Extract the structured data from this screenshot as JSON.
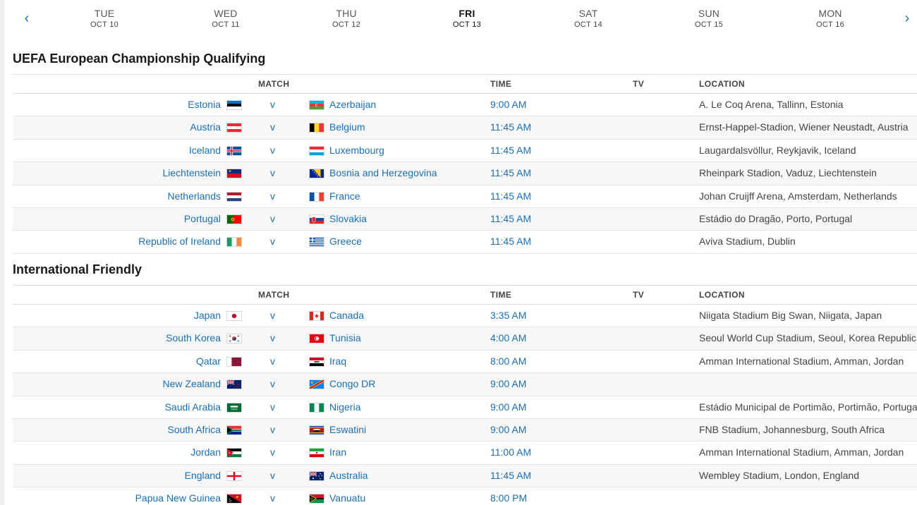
{
  "nav": {
    "prev_icon": "chevron-left-icon",
    "next_icon": "chevron-right-icon",
    "prev_glyph": "‹",
    "next_glyph": "›"
  },
  "days": [
    {
      "dow": "TUE",
      "date": "OCT 10",
      "active": false
    },
    {
      "dow": "WED",
      "date": "OCT 11",
      "active": false
    },
    {
      "dow": "THU",
      "date": "OCT 12",
      "active": false
    },
    {
      "dow": "FRI",
      "date": "OCT 13",
      "active": true
    },
    {
      "dow": "SAT",
      "date": "OCT 14",
      "active": false
    },
    {
      "dow": "SUN",
      "date": "OCT 15",
      "active": false
    },
    {
      "dow": "MON",
      "date": "OCT 16",
      "active": false
    }
  ],
  "columns": {
    "match": "MATCH",
    "time": "TIME",
    "tv": "TV",
    "location": "LOCATION"
  },
  "vs_label": "v",
  "colors": {
    "link": "#1a6fb5",
    "alt_row": "#f7f7f7"
  },
  "sections": [
    {
      "title": "UEFA European Championship Qualifying",
      "matches": [
        {
          "home": "Estonia",
          "home_flag": "estonia-flag-icon",
          "away": "Azerbaijan",
          "away_flag": "azerbaijan-flag-icon",
          "time": "9:00 AM",
          "location": "A. Le Coq Arena, Tallinn, Estonia"
        },
        {
          "home": "Austria",
          "home_flag": "austria-flag-icon",
          "away": "Belgium",
          "away_flag": "belgium-flag-icon",
          "time": "11:45 AM",
          "location": "Ernst-Happel-Stadion, Wiener Neustadt, Austria"
        },
        {
          "home": "Iceland",
          "home_flag": "iceland-flag-icon",
          "away": "Luxembourg",
          "away_flag": "luxembourg-flag-icon",
          "time": "11:45 AM",
          "location": "Laugardalsvöllur, Reykjavik, Iceland"
        },
        {
          "home": "Liechtenstein",
          "home_flag": "liechtenstein-flag-icon",
          "away": "Bosnia and Herzegovina",
          "away_flag": "bosnia-flag-icon",
          "time": "11:45 AM",
          "location": "Rheinpark Stadion, Vaduz, Liechtenstein"
        },
        {
          "home": "Netherlands",
          "home_flag": "netherlands-flag-icon",
          "away": "France",
          "away_flag": "france-flag-icon",
          "time": "11:45 AM",
          "location": "Johan Cruijff Arena, Amsterdam, Netherlands"
        },
        {
          "home": "Portugal",
          "home_flag": "portugal-flag-icon",
          "away": "Slovakia",
          "away_flag": "slovakia-flag-icon",
          "time": "11:45 AM",
          "location": "Estádio do Dragão, Porto, Portugal"
        },
        {
          "home": "Republic of Ireland",
          "home_flag": "ireland-flag-icon",
          "away": "Greece",
          "away_flag": "greece-flag-icon",
          "time": "11:45 AM",
          "location": "Aviva Stadium, Dublin"
        }
      ]
    },
    {
      "title": "International Friendly",
      "matches": [
        {
          "home": "Japan",
          "home_flag": "japan-flag-icon",
          "away": "Canada",
          "away_flag": "canada-flag-icon",
          "time": "3:35 AM",
          "location": "Niigata Stadium Big Swan, Niigata, Japan"
        },
        {
          "home": "South Korea",
          "home_flag": "south-korea-flag-icon",
          "away": "Tunisia",
          "away_flag": "tunisia-flag-icon",
          "time": "4:00 AM",
          "location": "Seoul World Cup Stadium, Seoul, Korea Republic"
        },
        {
          "home": "Qatar",
          "home_flag": "qatar-flag-icon",
          "away": "Iraq",
          "away_flag": "iraq-flag-icon",
          "time": "8:00 AM",
          "location": "Amman International Stadium, Amman, Jordan"
        },
        {
          "home": "New Zealand",
          "home_flag": "new-zealand-flag-icon",
          "away": "Congo DR",
          "away_flag": "congo-dr-flag-icon",
          "time": "9:00 AM",
          "location": ""
        },
        {
          "home": "Saudi Arabia",
          "home_flag": "saudi-arabia-flag-icon",
          "away": "Nigeria",
          "away_flag": "nigeria-flag-icon",
          "time": "9:00 AM",
          "location": "Estádio Municipal de Portimão, Portimão, Portugal"
        },
        {
          "home": "South Africa",
          "home_flag": "south-africa-flag-icon",
          "away": "Eswatini",
          "away_flag": "eswatini-flag-icon",
          "time": "9:00 AM",
          "location": "FNB Stadium, Johannesburg, South Africa"
        },
        {
          "home": "Jordan",
          "home_flag": "jordan-flag-icon",
          "away": "Iran",
          "away_flag": "iran-flag-icon",
          "time": "11:00 AM",
          "location": "Amman International Stadium, Amman, Jordan"
        },
        {
          "home": "England",
          "home_flag": "england-flag-icon",
          "away": "Australia",
          "away_flag": "australia-flag-icon",
          "time": "11:45 AM",
          "location": "Wembley Stadium, London, England"
        },
        {
          "home": "Papua New Guinea",
          "home_flag": "png-flag-icon",
          "away": "Vanuatu",
          "away_flag": "vanuatu-flag-icon",
          "time": "8:00 PM",
          "location": ""
        }
      ]
    }
  ]
}
